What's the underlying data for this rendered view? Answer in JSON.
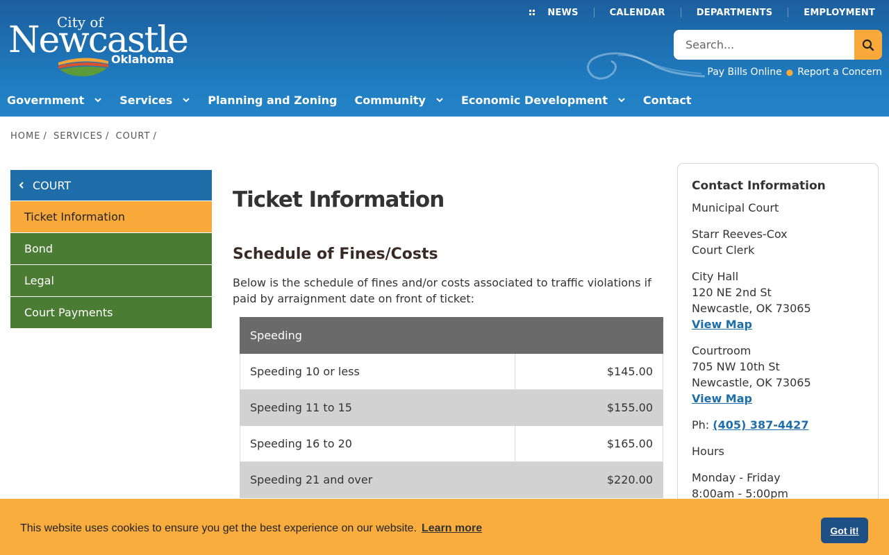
{
  "logo": {
    "line1": "City of",
    "line2": "Newcastle",
    "line3": "Oklahoma"
  },
  "utility_nav": [
    "NEWS",
    "CALENDAR",
    "DEPARTMENTS",
    "EMPLOYMENT"
  ],
  "search": {
    "placeholder": "Search..."
  },
  "quick_links": {
    "pay": "Pay Bills Online",
    "report": "Report a Concern"
  },
  "main_nav": [
    "Government",
    "Services",
    "Planning and Zoning",
    "Community",
    "Economic Development",
    "Contact"
  ],
  "breadcrumb": [
    "HOME",
    "SERVICES",
    "COURT"
  ],
  "sidebar": {
    "heading": "COURT",
    "items": [
      "Ticket Information",
      "Bond",
      "Legal",
      "Court Payments"
    ]
  },
  "content": {
    "title": "Ticket Information",
    "subtitle": "Schedule of Fines/Costs",
    "intro": "Below is the schedule of fines and/or costs associated to traffic violations if paid by arraignment date on front of ticket:",
    "table_header": "Speeding",
    "rows": [
      {
        "label": "Speeding 10 or less",
        "amount": "$145.00"
      },
      {
        "label": "Speeding 11 to 15",
        "amount": "$155.00"
      },
      {
        "label": "Speeding 16 to 20",
        "amount": "$165.00"
      },
      {
        "label": "Speeding 21 and over",
        "amount": "$220.00"
      }
    ]
  },
  "contact": {
    "heading": "Contact Information",
    "dept": "Municipal Court",
    "person_name": "Starr Reeves-Cox",
    "person_title": "Court Clerk",
    "loc1_name": "City Hall",
    "loc1_street": "120 NE 2nd St",
    "loc1_city": "Newcastle, OK 73065",
    "loc1_map": "View Map",
    "loc2_name": "Courtroom",
    "loc2_street": "705 NW 10th St",
    "loc2_city": "Newcastle, OK 73065",
    "loc2_map": "View Map",
    "phone_label": "Ph:",
    "phone": "(405) 387-4427",
    "hours_label": "Hours",
    "hours_days": "Monday - Friday",
    "hours_time": "8:00am - 5:00pm"
  },
  "cookie": {
    "message": "This website uses cookies to ensure you get the best experience on our website.",
    "learn_more": "Learn more",
    "accept": "Got it!"
  },
  "colors": {
    "header_blue": "#1f7cc0",
    "accent_orange": "#f9a93a",
    "sidebar_green": "#4a7c34",
    "sidebar_blue": "#1f6da8",
    "cookie_button": "#1e4f85"
  }
}
